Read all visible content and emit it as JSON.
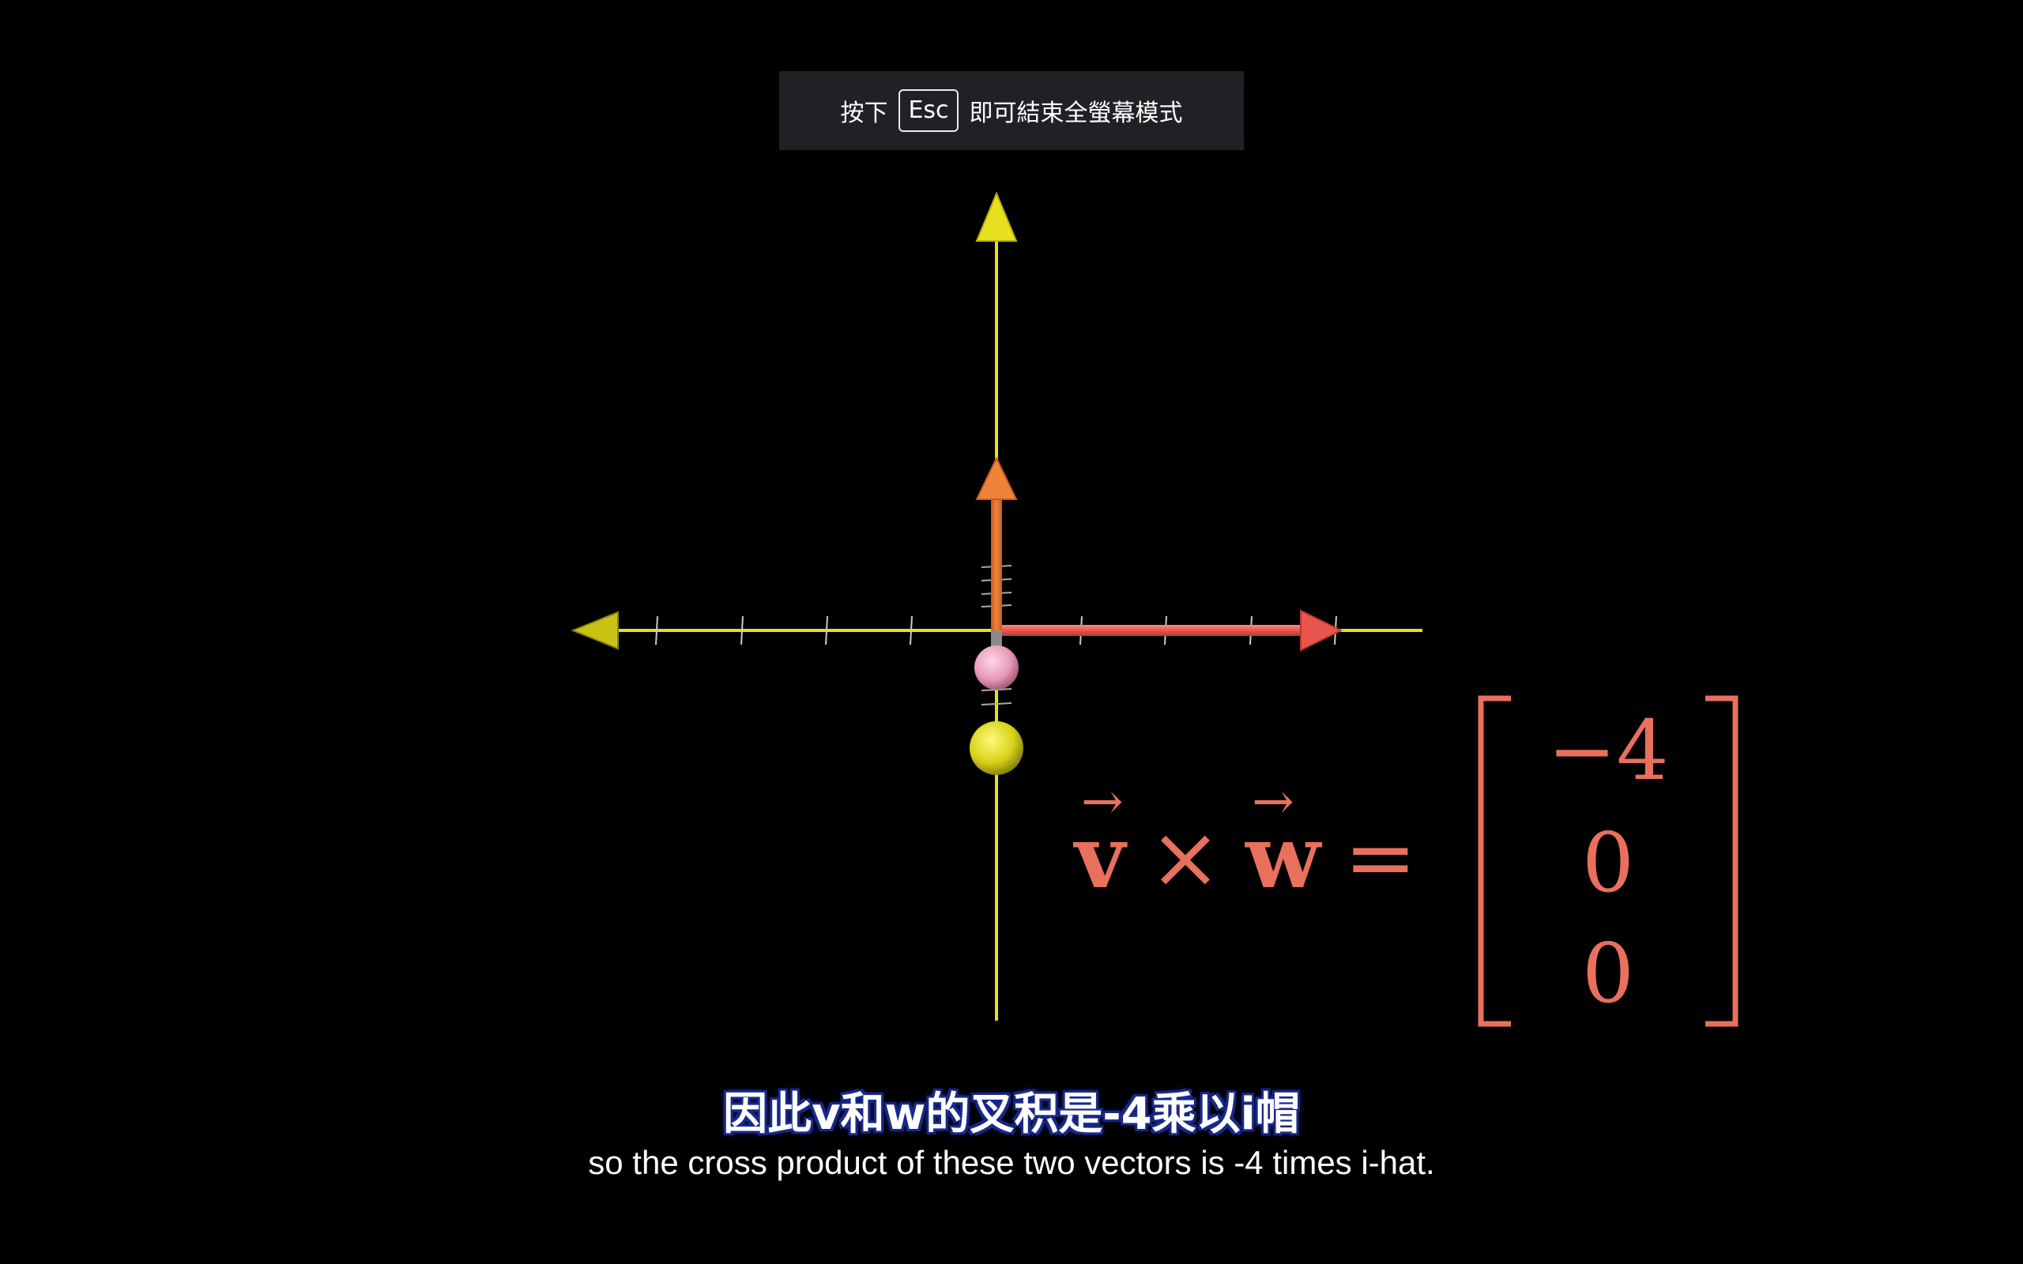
{
  "fullscreen_banner": {
    "prefix": "按下",
    "key": "Esc",
    "suffix": "即可結束全螢幕模式"
  },
  "formula": {
    "v": "v",
    "cross": "×",
    "w": "w",
    "equals": "=",
    "arrow": "→",
    "matrix": [
      "−4",
      "0",
      "0"
    ]
  },
  "subtitles": {
    "zh": "因此v和w的叉积是-4乘以i帽",
    "en": "so the cross product of these two vectors is -4 times i-hat."
  },
  "colors": {
    "axis": "#e6e01e",
    "vector_red": "#e8564e",
    "vector_orange": "#f0833a",
    "formula": "#e8705d",
    "pink_sphere": "#e89ab8",
    "yellow_sphere": "#d8d21a"
  }
}
